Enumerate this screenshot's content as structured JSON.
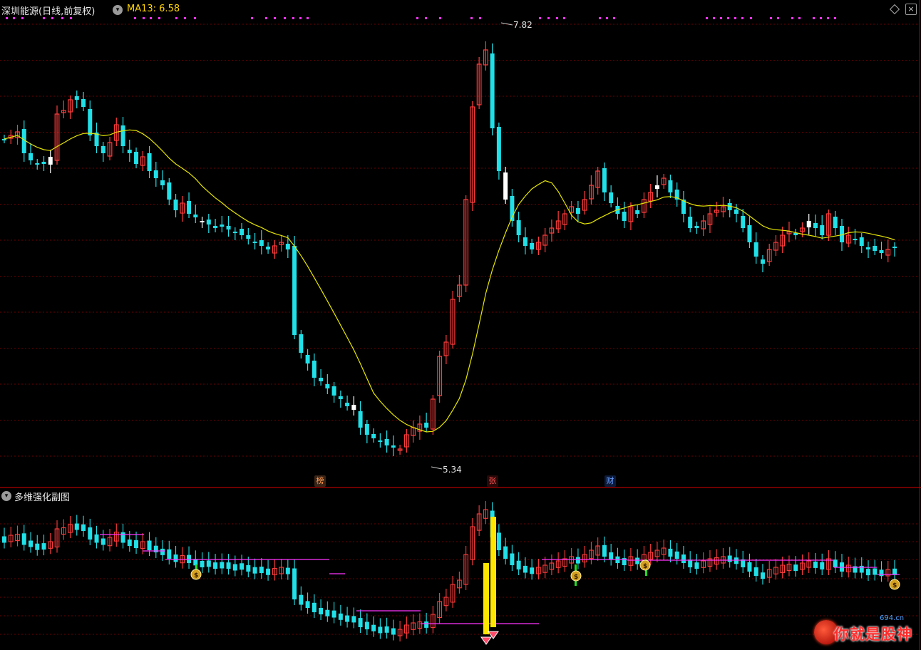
{
  "header": {
    "title": "深圳能源(日线,前复权)",
    "ma_label": "MA13: 6.58",
    "dropdown_icon": "chevron-down-icon",
    "expand_icon": "diamond-icon",
    "close_icon": "close-icon",
    "close_glyph": "×"
  },
  "indicator": {
    "title": "多维强化副图",
    "dropdown_glyph": "▾",
    "icons": [
      "money-bag-icon",
      "diamond-gem-icon"
    ],
    "money_symbol": "$"
  },
  "price_labels": {
    "high": "7.82",
    "low": "5.34"
  },
  "event_tags": [
    {
      "label": "榜",
      "color": "#c0703c"
    },
    {
      "label": "张",
      "color": "#b83a3a"
    },
    {
      "label": "财",
      "color": "#3a6ad0"
    }
  ],
  "watermark": {
    "text": "你就是股神",
    "url": "694.cn"
  },
  "colors": {
    "up": "#ff3c3c",
    "down": "#20e0e8",
    "neutral": "#ffffff",
    "ma": "#e6e600",
    "magenta": "#ff33ff",
    "grid": "#6a0000",
    "divider": "#b00000",
    "yellow_bar": "#ffe600"
  },
  "chart_data": {
    "type": "candlestick",
    "series_ma": "MA13",
    "ma_value_shown": 6.58,
    "high": 7.82,
    "low": 5.34
  }
}
